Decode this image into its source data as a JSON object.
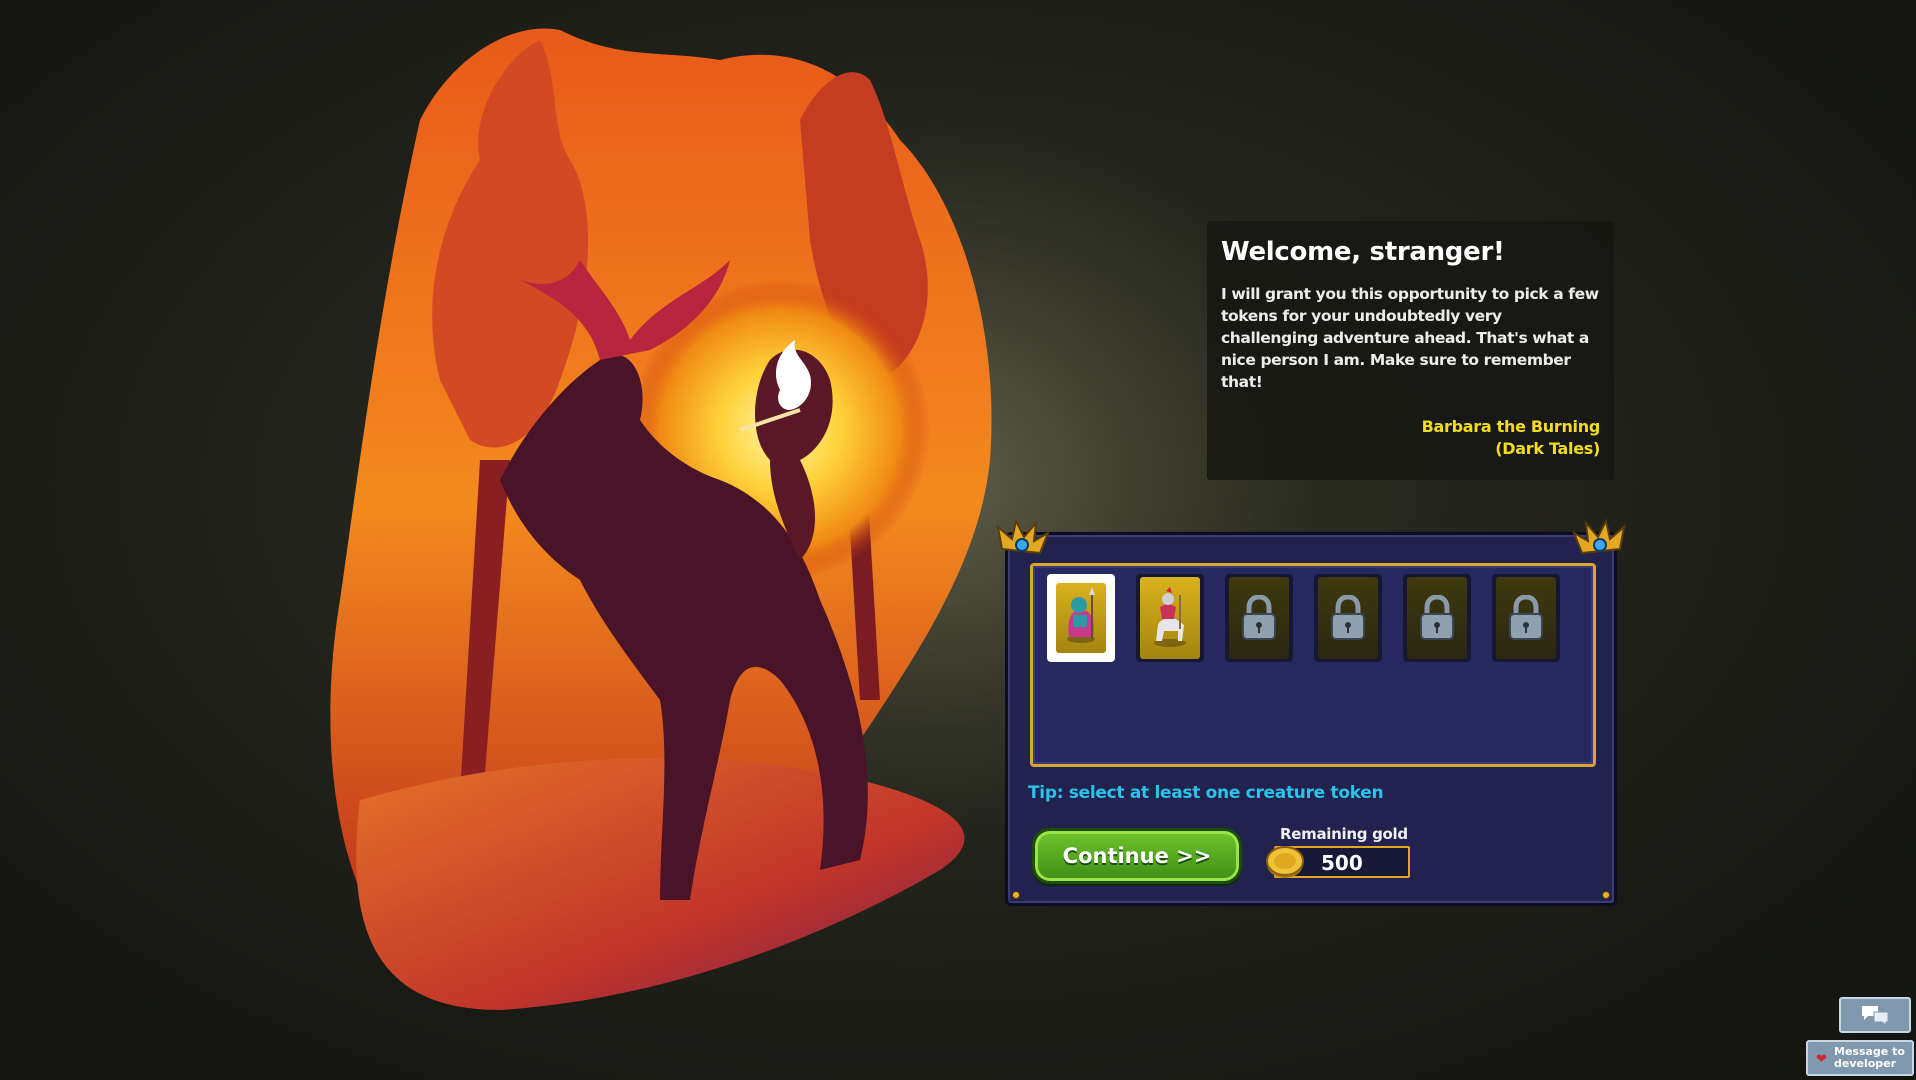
{
  "welcome": {
    "title": "Welcome, stranger!",
    "body": "I will grant you this opportunity to pick a few tokens for your undoubtedly very challenging adventure ahead. That's what a nice person I am. Make sure to remember that!",
    "author_line1": "Barbara the Burning",
    "author_line2": "(Dark Tales)"
  },
  "tokens": [
    {
      "name": "spear-guard-token",
      "state": "selected"
    },
    {
      "name": "knight-on-horse-token",
      "state": "available"
    },
    {
      "name": "lock-icon",
      "state": "locked"
    },
    {
      "name": "lock-icon",
      "state": "locked"
    },
    {
      "name": "lock-icon",
      "state": "locked"
    },
    {
      "name": "lock-icon",
      "state": "locked"
    }
  ],
  "tip": "Tip: select at least one creature token",
  "continue_label": "Continue >>",
  "gold": {
    "label": "Remaining gold",
    "value": "500"
  },
  "message_to_developer": "Message to developer",
  "colors": {
    "panel_bg": "#22224e",
    "frame_gold": "#d9a52a",
    "tip_cyan": "#29c4ea",
    "author_yellow": "#f2dc1b",
    "continue_green": "#4fa81f"
  }
}
